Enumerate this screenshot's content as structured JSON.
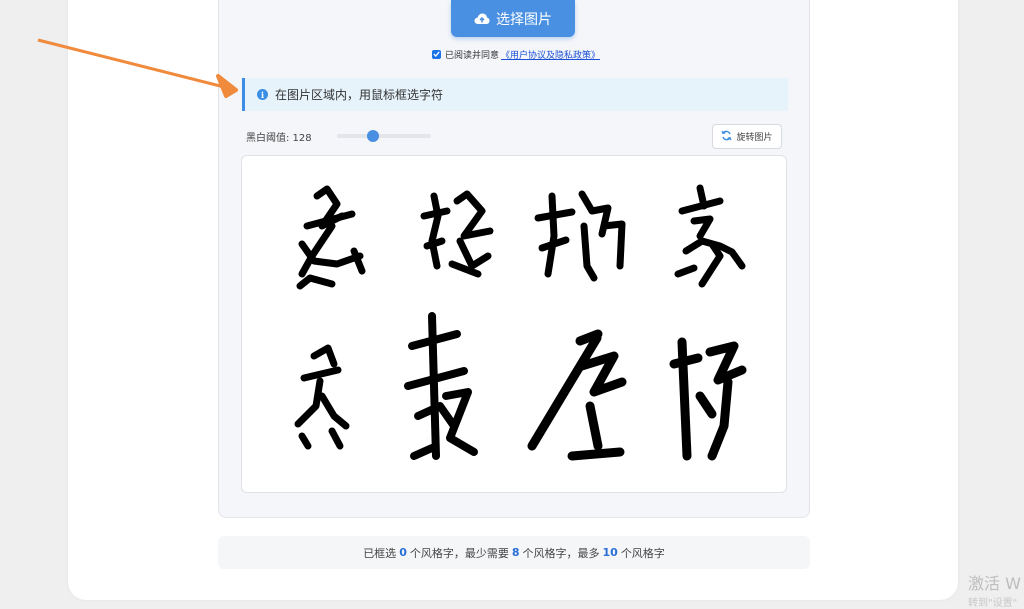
{
  "upload": {
    "label": "选择图片",
    "icon": "cloud-upload-icon"
  },
  "agreement": {
    "prefix": "已阅读并同意",
    "link": "《用户协议及隐私政策》",
    "checked": true
  },
  "tip": {
    "text": "在图片区域内，用鼠标框选字符",
    "icon": "info-icon"
  },
  "threshold": {
    "label": "黑白阈值: 128",
    "value": 128,
    "max": 255,
    "fraction": 0.38
  },
  "rotate": {
    "label": "旋转图片",
    "icon": "rotate-icon"
  },
  "status": {
    "part1": "已框选",
    "selected": "0",
    "part2": "个风格字，最少需要",
    "min": "8",
    "part3": "个风格字，最多",
    "max": "10",
    "part4": "个风格字"
  },
  "watermark": {
    "line1": "激活 W",
    "line2": "转到\"设置\""
  },
  "colors": {
    "accent": "#4a90e2",
    "link": "#1a4fd6",
    "tip_bg": "#e6f3fb",
    "arrow": "#f08a3c"
  }
}
